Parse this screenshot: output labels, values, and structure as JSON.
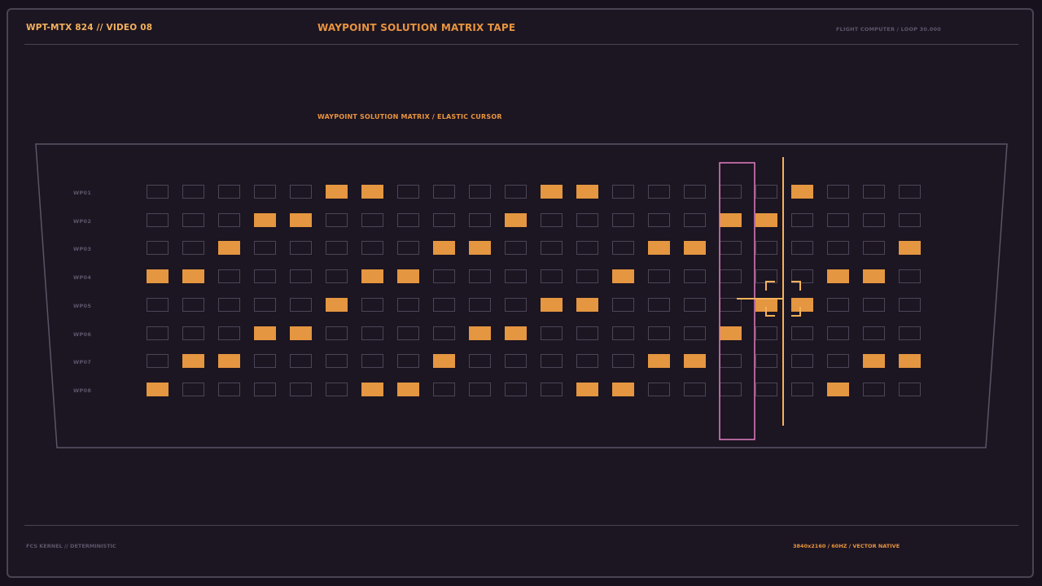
{
  "header": {
    "left": "WPT-MTX 824 // VIDEO 08",
    "title": "WAYPOINT SOLUTION MATRIX TAPE",
    "right": "FLIGHT COMPUTER / LOOP 30.000"
  },
  "panel": {
    "title": "WAYPOINT SOLUTION MATRIX / ELASTIC CURSOR"
  },
  "footer": {
    "left": "FCS KERNEL // DETERMINISTIC",
    "right": "3840x2160 / 60HZ / VECTOR NATIVE"
  },
  "colors": {
    "background": "#1c1522",
    "accent": "#e49640",
    "cursor_column": "#e07ec2",
    "cursor": "#f4b25a",
    "grid_line": "#4c4556"
  },
  "matrix": {
    "columns": 22,
    "rows": [
      {
        "label": "WP01",
        "cells": [
          0,
          0,
          0,
          0,
          0,
          1,
          1,
          0,
          0,
          0,
          0,
          1,
          1,
          0,
          0,
          0,
          0,
          0,
          1,
          0,
          0,
          0
        ]
      },
      {
        "label": "WP02",
        "cells": [
          0,
          0,
          0,
          1,
          1,
          0,
          0,
          0,
          0,
          0,
          1,
          0,
          0,
          0,
          0,
          0,
          1,
          1,
          0,
          0,
          0,
          0
        ]
      },
      {
        "label": "WP03",
        "cells": [
          0,
          0,
          1,
          0,
          0,
          0,
          0,
          0,
          1,
          1,
          0,
          0,
          0,
          0,
          1,
          1,
          0,
          0,
          0,
          0,
          0,
          1
        ]
      },
      {
        "label": "WP04",
        "cells": [
          1,
          1,
          0,
          0,
          0,
          0,
          1,
          1,
          0,
          0,
          0,
          0,
          0,
          1,
          0,
          0,
          0,
          0,
          0,
          1,
          1,
          0
        ]
      },
      {
        "label": "WP05",
        "cells": [
          0,
          0,
          0,
          0,
          0,
          1,
          0,
          0,
          0,
          0,
          0,
          1,
          1,
          0,
          0,
          0,
          0,
          1,
          1,
          0,
          0,
          0
        ]
      },
      {
        "label": "WP06",
        "cells": [
          0,
          0,
          0,
          1,
          1,
          0,
          0,
          0,
          0,
          1,
          1,
          0,
          0,
          0,
          0,
          0,
          1,
          0,
          0,
          0,
          0,
          0
        ]
      },
      {
        "label": "WP07",
        "cells": [
          0,
          1,
          1,
          0,
          0,
          0,
          0,
          0,
          1,
          0,
          0,
          0,
          0,
          0,
          1,
          1,
          0,
          0,
          0,
          0,
          1,
          1
        ]
      },
      {
        "label": "WP08",
        "cells": [
          1,
          0,
          0,
          0,
          0,
          0,
          1,
          1,
          0,
          0,
          0,
          0,
          1,
          1,
          0,
          0,
          0,
          0,
          0,
          1,
          0,
          0
        ]
      }
    ],
    "highlight_column": 17,
    "cursor_row": 5,
    "cursor_column": 18
  }
}
